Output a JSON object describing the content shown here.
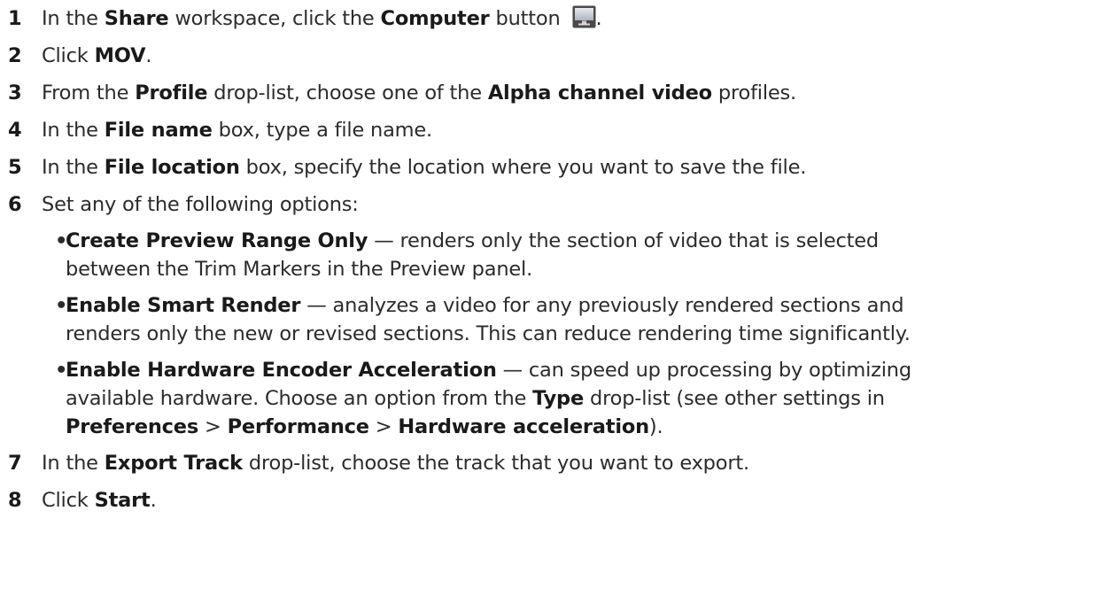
{
  "steps": [
    {
      "num": "1",
      "parts": [
        "In the ",
        "Share",
        " workspace, click the ",
        "Computer",
        " button "
      ],
      "icon": "monitor-icon",
      "tail": "."
    },
    {
      "num": "2",
      "parts": [
        "Click ",
        "MOV",
        "."
      ]
    },
    {
      "num": "3",
      "parts": [
        "From the ",
        "Profile",
        " drop-list, choose one of the ",
        "Alpha channel video",
        " profiles."
      ]
    },
    {
      "num": "4",
      "parts": [
        "In the ",
        "File name",
        " box, type a file name."
      ]
    },
    {
      "num": "5",
      "parts": [
        "In the ",
        "File location",
        " box, specify the location where you want to save the file."
      ]
    },
    {
      "num": "6",
      "parts": [
        "Set any of the following options:"
      ]
    },
    {
      "num": "7",
      "parts": [
        "In the ",
        "Export Track",
        " drop-list, choose the track that you want to export."
      ]
    },
    {
      "num": "8",
      "parts": [
        "Click ",
        "Start",
        "."
      ]
    }
  ],
  "options": [
    {
      "bullet": "•",
      "title": "Create Preview Range Only",
      "line1": " — renders only the section of video that is selected",
      "line2": "between the Trim Markers in the Preview panel."
    },
    {
      "bullet": "•",
      "title": "Enable Smart Render",
      "line1": " — analyzes a video for any previously rendered sections and",
      "line2": "renders only the new or revised sections. This can reduce rendering time significantly."
    },
    {
      "bullet": "•",
      "title": "Enable Hardware Encoder Acceleration",
      "line1": " — can speed up processing by optimizing",
      "line2_parts": [
        "available hardware. Choose an option from the ",
        "Type",
        " drop-list (see other settings in"
      ],
      "line3_parts": [
        "Preferences",
        " > ",
        "Performance",
        " > ",
        "Hardware acceleration",
        ")."
      ]
    }
  ],
  "colors": {
    "text": "#2b2b2b",
    "bold": "#1a1a1a",
    "icon_bezel": "#3a3a3a",
    "icon_screen": "#c9ced6"
  }
}
